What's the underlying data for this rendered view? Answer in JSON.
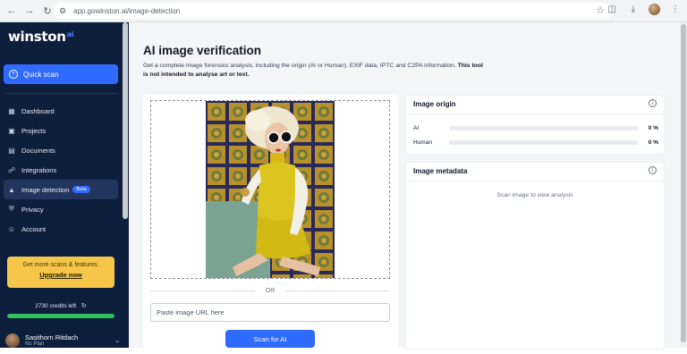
{
  "browser": {
    "url": "app.gowinston.ai/image-detection",
    "icons": [
      "back-icon",
      "forward-icon",
      "reload-icon",
      "site-info-icon",
      "bookmark-star-icon",
      "extensions-icon",
      "downloads-icon",
      "profile-icon",
      "menu-icon"
    ]
  },
  "sidebar": {
    "logo_text": "winston",
    "logo_suffix": "ai",
    "quick_scan": "Quick scan",
    "items": [
      {
        "label": "Dashboard",
        "icon": "grid-icon"
      },
      {
        "label": "Projects",
        "icon": "folder-grid-icon"
      },
      {
        "label": "Documents",
        "icon": "document-icon"
      },
      {
        "label": "Integrations",
        "icon": "plug-icon"
      },
      {
        "label": "Image detection",
        "icon": "image-icon",
        "badge": "Beta",
        "active": true
      },
      {
        "label": "Privacy",
        "icon": "shield-icon"
      },
      {
        "label": "Account",
        "icon": "user-icon"
      }
    ],
    "upgrade": {
      "text": "Get more scans & features.",
      "link": "Upgrade now"
    },
    "credits": {
      "label": "2730 credits left",
      "fraction": 1.0
    },
    "user": {
      "name": "Sasithorn Ritdach",
      "plan": "No Plan"
    },
    "colors": {
      "background": "#0e1e3d",
      "accent": "#2f6bff",
      "upgrade": "#f5c64a",
      "credit_bar": "#2fc15a"
    }
  },
  "main": {
    "title": "AI image verification",
    "subtitle_plain": "Get a complete image forensics analysis, including the origin (AI or Human), EXIF data, IPTC and C2PA information. ",
    "subtitle_bold": "This tool is not intended to analyse art or text.",
    "upload": {
      "or_label": "OR",
      "url_placeholder": "Paste image URL here",
      "scan_button": "Scan for AI"
    },
    "origin": {
      "title": "Image origin",
      "rows": [
        {
          "label": "AI",
          "value": "0 %",
          "fraction": 0
        },
        {
          "label": "Human",
          "value": "0 %",
          "fraction": 0
        }
      ]
    },
    "metadata": {
      "title": "Image metadata",
      "empty_text": "Scan image to view analysis"
    }
  }
}
